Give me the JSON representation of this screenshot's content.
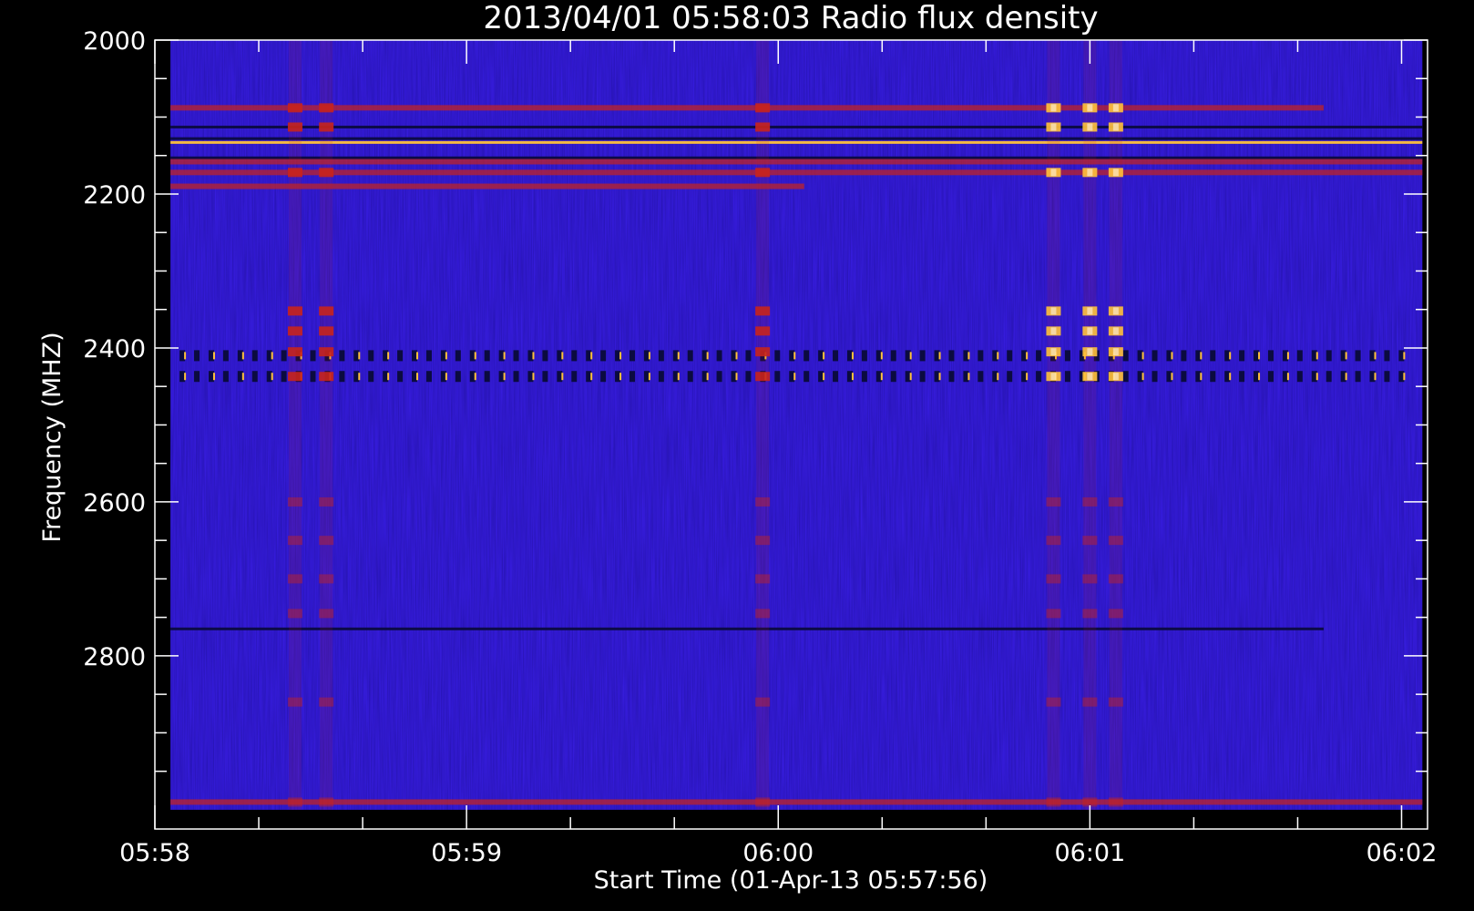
{
  "chart_data": {
    "type": "heatmap",
    "title": "2013/04/01 05:58:03 Radio flux density",
    "xlabel": "Start Time (01-Apr-13 05:57:56)",
    "ylabel": "Frequency (MHZ)",
    "x_tick_labels": [
      "05:58",
      "05:59",
      "06:00",
      "06:01",
      "06:02"
    ],
    "y_tick_labels": [
      "2000",
      "2200",
      "2400",
      "2600",
      "2800"
    ],
    "y_ticks": [
      2000,
      2200,
      2400,
      2600,
      2800
    ],
    "xlim": [
      "05:58:00",
      "06:02:05"
    ],
    "ylim": [
      2000,
      3025
    ],
    "y_inverted": true,
    "data_time_range": [
      "05:58:03",
      "06:02:04"
    ],
    "data_freq_range": [
      2000,
      3000
    ],
    "colormap": {
      "background": "#3a1ee8",
      "low": "#0b0b40",
      "mid": "#c8241c",
      "high": "#ffc23a",
      "peak": "#ffffff"
    },
    "horizontal_bands_mhz": [
      {
        "freq": 2088,
        "intensity": "mid",
        "extent": "partial"
      },
      {
        "freq": 2113,
        "intensity": "low",
        "extent": "full"
      },
      {
        "freq": 2128,
        "intensity": "low",
        "extent": "full"
      },
      {
        "freq": 2133,
        "intensity": "high",
        "extent": "full"
      },
      {
        "freq": 2153,
        "intensity": "low",
        "extent": "full"
      },
      {
        "freq": 2158,
        "intensity": "mid",
        "extent": "full"
      },
      {
        "freq": 2172,
        "intensity": "mid",
        "extent": "full"
      },
      {
        "freq": 2190,
        "intensity": "mid",
        "extent": "left"
      },
      {
        "freq": 2410,
        "intensity": "low",
        "extent": "full",
        "dashed": true
      },
      {
        "freq": 2437,
        "intensity": "low",
        "extent": "full",
        "dashed": true
      },
      {
        "freq": 2765,
        "intensity": "low",
        "extent": "partial"
      },
      {
        "freq": 2990,
        "intensity": "mid",
        "extent": "full"
      }
    ],
    "burst_columns": [
      {
        "time": "05:58:27",
        "intensity": "mid"
      },
      {
        "time": "05:58:33",
        "intensity": "mid"
      },
      {
        "time": "05:59:57",
        "intensity": "mid"
      },
      {
        "time": "06:00:53",
        "intensity": "high"
      },
      {
        "time": "06:01:00",
        "intensity": "high"
      },
      {
        "time": "06:01:05",
        "intensity": "high"
      }
    ],
    "grid": false,
    "legend": "none"
  }
}
